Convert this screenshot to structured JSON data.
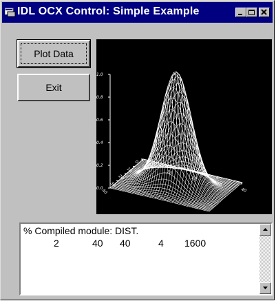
{
  "window": {
    "title": "IDL OCX Control: Simple Example",
    "controls": [
      "minimize-icon",
      "maximize-icon",
      "close-icon"
    ]
  },
  "buttons": {
    "plot_label": "Plot Data",
    "exit_label": "Exit"
  },
  "plot": {
    "type": "3d-surface",
    "z_ticks": [
      "0.0",
      "0.2",
      "0.4",
      "0.6",
      "0.8",
      "1.0"
    ],
    "x_ticks": [
      "0",
      "10",
      "20",
      "30",
      "40"
    ],
    "y_ticks": [
      "0",
      "10",
      "20",
      "30",
      "40"
    ],
    "colors": {
      "background": "#000000",
      "lines": "#ffffff"
    }
  },
  "log": {
    "line1": "% Compiled module: DIST.",
    "values": [
      "2",
      "40",
      "40",
      "4",
      "1600"
    ]
  }
}
